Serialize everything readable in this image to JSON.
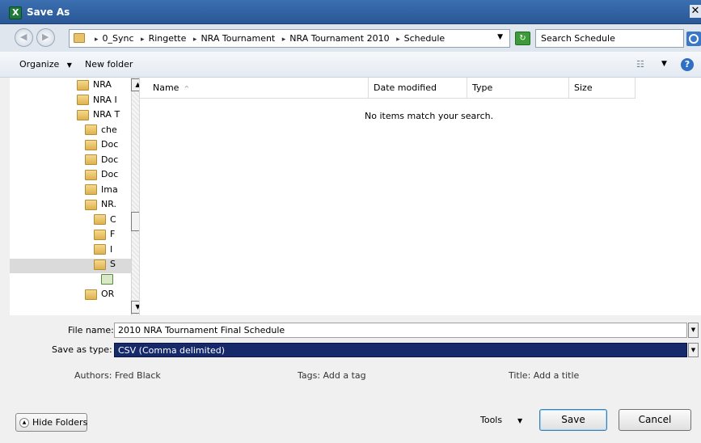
{
  "window": {
    "title": "Save As",
    "close_glyph": "✕"
  },
  "address": {
    "crumbs": [
      "0_Sync",
      "Ringette",
      "NRA Tournament",
      "NRA Tournament 2010",
      "Schedule"
    ],
    "search_placeholder": "Search Schedule"
  },
  "toolbar": {
    "organize": "Organize",
    "new_folder": "New folder"
  },
  "navpane": {
    "items": [
      {
        "label": "NRA ",
        "indent": 1
      },
      {
        "label": "NRA I",
        "indent": 1
      },
      {
        "label": "NRA T",
        "indent": 1
      },
      {
        "label": "che",
        "indent": 2
      },
      {
        "label": "Doc",
        "indent": 2
      },
      {
        "label": "Doc",
        "indent": 2
      },
      {
        "label": "Doc",
        "indent": 2
      },
      {
        "label": "Ima",
        "indent": 2
      },
      {
        "label": "NR.",
        "indent": 2
      },
      {
        "label": "C",
        "indent": 3
      },
      {
        "label": "F",
        "indent": 3
      },
      {
        "label": "I",
        "indent": 3
      },
      {
        "label": "S",
        "indent": 3
      },
      {
        "label": "",
        "indent": 4
      },
      {
        "label": "OR",
        "indent": 2
      }
    ]
  },
  "filelist": {
    "columns": {
      "name": "Name",
      "date": "Date modified",
      "type": "Type",
      "size": "Size"
    },
    "empty_message": "No items match your search."
  },
  "form": {
    "filename_label": "File name:",
    "filename_value": "2010 NRA Tournament Final Schedule",
    "savetype_label": "Save as type:",
    "savetype_value": "CSV (Comma delimited)",
    "authors": "Authors: Fred Black",
    "tags": "Tags: Add a tag",
    "title": "Title: Add a title"
  },
  "buttons": {
    "hide_folders": "Hide Folders",
    "tools": "Tools",
    "save": "Save",
    "cancel": "Cancel"
  }
}
